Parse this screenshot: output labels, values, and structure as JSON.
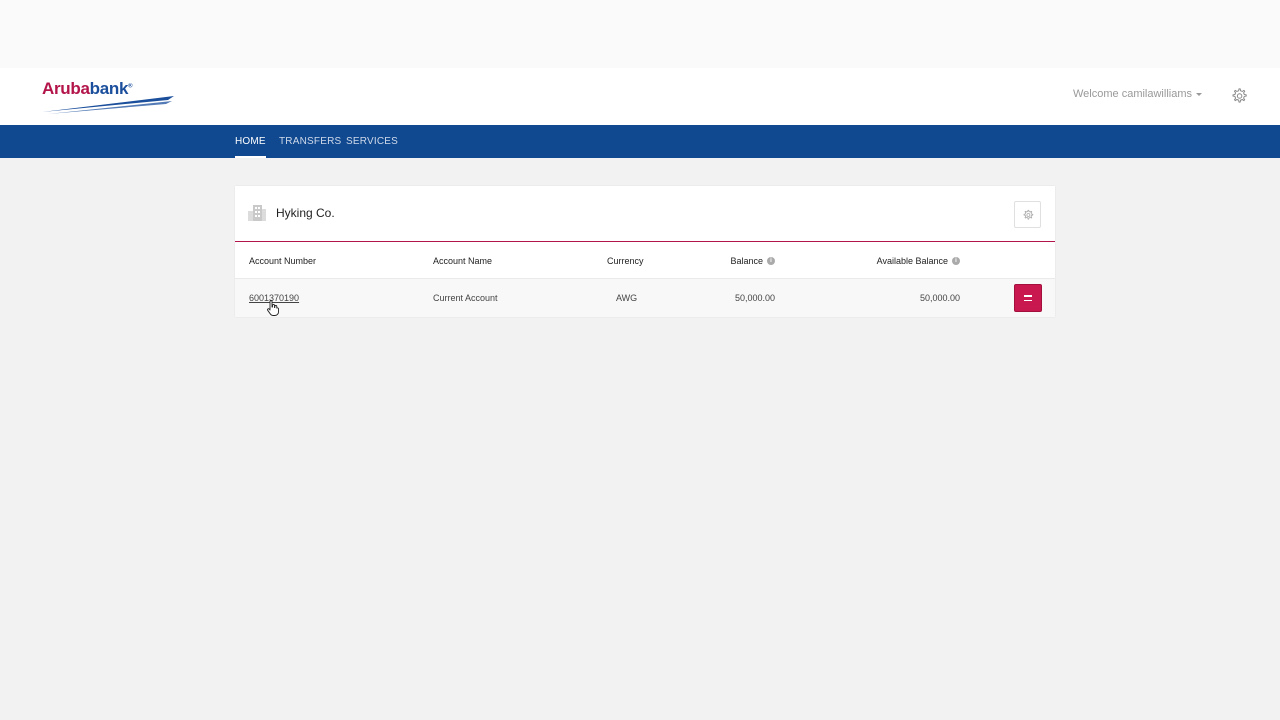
{
  "brand": {
    "name_part1": "Aruba",
    "name_part2": "bank",
    "trademark": "®",
    "primary_color": "#b3154a",
    "secondary_color": "#1b4f9c",
    "nav_color": "#10498f"
  },
  "header": {
    "welcome_text": "Welcome camilawilliams",
    "settings_icon": "gear-icon"
  },
  "nav": {
    "items": [
      {
        "label": "HOME",
        "active": true
      },
      {
        "label": "TRANSFERS",
        "active": false
      },
      {
        "label": "SERVICES",
        "active": false
      }
    ]
  },
  "panel": {
    "company_name": "Hyking Co.",
    "company_icon": "building-icon",
    "settings_icon": "gear-icon",
    "columns": {
      "account_number": "Account Number",
      "account_name": "Account Name",
      "currency": "Currency",
      "balance": "Balance",
      "available_balance": "Available Balance"
    },
    "rows": [
      {
        "account_number": "6001370190",
        "account_name": "Current Account",
        "currency": "AWG",
        "balance": "50,000.00",
        "available_balance": "50,000.00",
        "action_icon": "menu-icon"
      }
    ]
  }
}
